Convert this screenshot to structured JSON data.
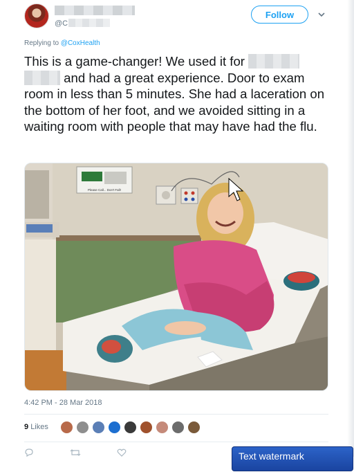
{
  "tweet": {
    "handle_prefix": "@C",
    "follow_label": "Follow",
    "replying_prefix": "Replying to",
    "replying_mention": "@CoxHealth",
    "text_part1": "This is a game-changer! We used it for",
    "text_part2": "and had a great experience. Door to exam room in less than 5 minutes. She had a laceration on the bottom of her foot, and we avoided sitting in a waiting room with people that may have had the flu.",
    "timestamp": "4:42 PM - 28 Mar 2018",
    "likes_count": "9",
    "likes_label": "Likes",
    "photo_sign_text": "Please Call... Don't Fall!"
  },
  "watermark": {
    "text": "Text watermark"
  },
  "colors": {
    "accent": "#1da1f2",
    "muted": "#657786",
    "text": "#14171a"
  },
  "icons": [
    "chevron-down-icon",
    "reply-icon",
    "retweet-icon",
    "like-icon",
    "cursor-icon"
  ]
}
